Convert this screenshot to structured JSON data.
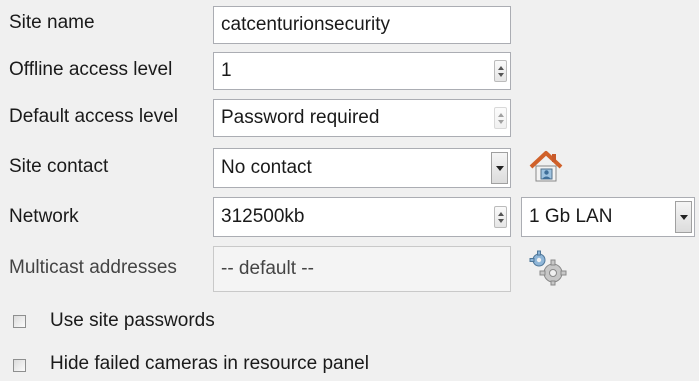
{
  "site_name": {
    "label": "Site name",
    "value": "catcenturionsecurity"
  },
  "offline_access_level": {
    "label": "Offline access level",
    "value": "1"
  },
  "default_access_level": {
    "label": "Default access level",
    "value": "Password required"
  },
  "site_contact": {
    "label": "Site contact",
    "value": "No contact",
    "icon": "house-icon"
  },
  "network": {
    "label": "Network",
    "value": "312500kb",
    "lan_value": "1 Gb LAN"
  },
  "multicast_addresses": {
    "label": "Multicast addresses",
    "value": "-- default --",
    "icon": "settings-gear-icon"
  },
  "use_site_passwords": {
    "label": "Use site passwords",
    "checked": false
  },
  "hide_failed_cameras": {
    "label": "Hide failed cameras in resource panel",
    "checked": false
  }
}
